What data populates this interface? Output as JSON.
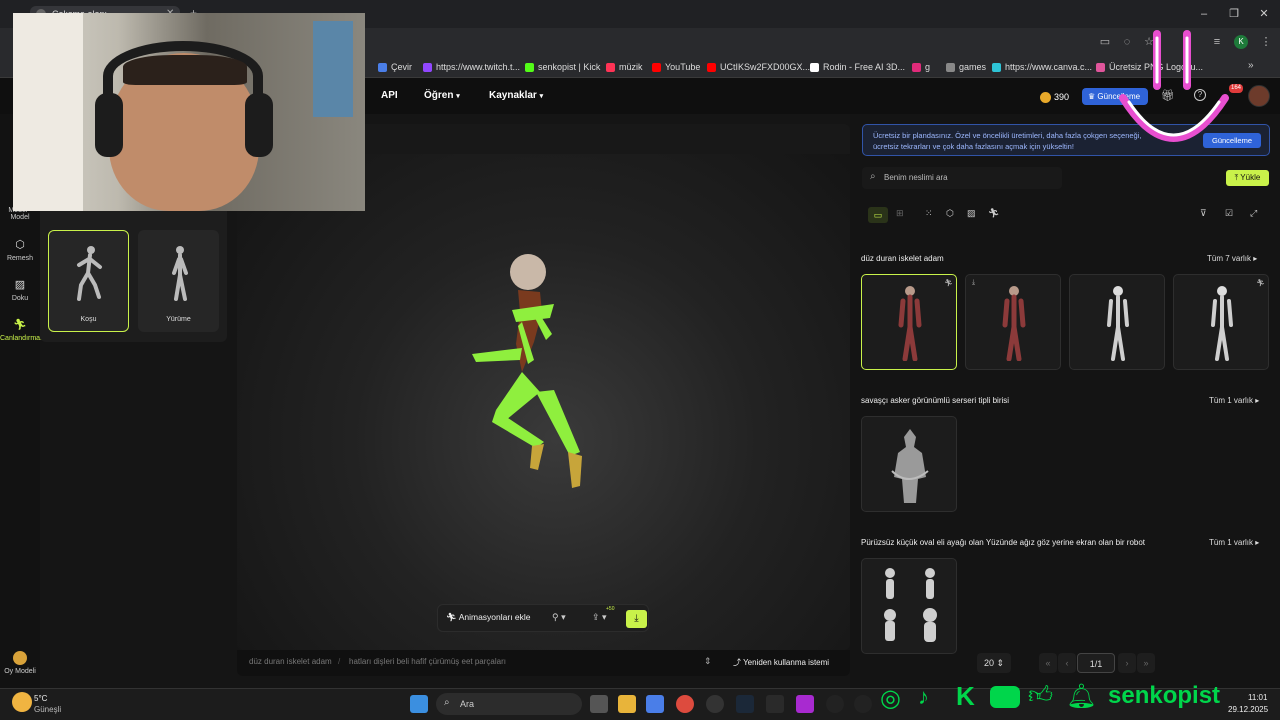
{
  "browser": {
    "tab_title": "Çalışma alanı",
    "bookmarks": [
      {
        "label": "Çevir",
        "color": "#4a7ee8"
      },
      {
        "label": "https://www.twitch.t...",
        "color": "#9147ff"
      },
      {
        "label": "senkopist | Kick",
        "color": "#53fc18"
      },
      {
        "label": "müzik",
        "color": "#ff3355"
      },
      {
        "label": "YouTube",
        "color": "#ff0000"
      },
      {
        "label": "UCtIKSw2FXD00GX...",
        "color": "#ff0000"
      },
      {
        "label": "Rodin - Free AI 3D...",
        "color": "#ffffff"
      },
      {
        "label": "g",
        "color": "#e02b7a"
      },
      {
        "label": "games",
        "color": "#888888"
      },
      {
        "label": "https://www.canva.c...",
        "color": "#2ec4d6"
      },
      {
        "label": "Ücretsiz PNG Logosu...",
        "color": "#e0559b"
      }
    ],
    "more_badge": "»",
    "profile_letter": "K"
  },
  "header": {
    "nav": [
      {
        "label": "API"
      },
      {
        "label": "Öğren"
      },
      {
        "label": "Kaynaklar"
      }
    ],
    "credits": "390",
    "upgrade_label": "Güncelleme",
    "notif_count": "164"
  },
  "rail": {
    "items": [
      {
        "label": "Model - Model",
        "icon": "cube-icon"
      },
      {
        "label": "Remesh",
        "icon": "remesh-icon"
      },
      {
        "label": "Doku",
        "icon": "texture-icon"
      },
      {
        "label": "Canlandırmak",
        "icon": "run-icon"
      },
      {
        "label": "Oy Modeli",
        "icon": "vote-icon"
      }
    ]
  },
  "animations": [
    {
      "label": "Koşu"
    },
    {
      "label": "Yürüme"
    }
  ],
  "viewport": {
    "toolbar": {
      "add_animations": "Animasyonları ekle",
      "export_badge": "+50"
    },
    "breadcrumb": [
      "düz duran iskelet adam",
      "hatları dişleri beli hafif çürümüş eet parçaları"
    ],
    "reuse_label": "Yeniden kullanma istemi"
  },
  "right": {
    "notice_line1": "Ücretsiz bir plandasınız. Özel ve öncelikli üretimleri, daha fazla çokgen seçeneği,",
    "notice_line2": "ücretsiz tekrarları ve çok daha fazlasını açmak için yükseltin!",
    "notice_button": "Güncelleme",
    "search_placeholder": "Benim neslimi ara",
    "upload_label": "Yükle",
    "sections": [
      {
        "title": "düz duran iskelet adam",
        "all": "Tüm 7 varlık"
      },
      {
        "title": "savaşçı asker görünümlü serseri tipli birisi",
        "all": "Tüm 1 varlık"
      },
      {
        "title": "Pürüzsüz küçük oval eli ayağı olan Yüzünde ağız göz yerine ekran olan bir robot",
        "all": "Tüm 1 varlık"
      }
    ],
    "page_size": "20",
    "page": "1/1"
  },
  "taskbar": {
    "weather_temp": "5°C",
    "weather_desc": "Güneşli",
    "search_placeholder": "Ara",
    "time": "11:01",
    "date": "29.12.2025"
  },
  "overlay": {
    "handle": "senkopist"
  }
}
